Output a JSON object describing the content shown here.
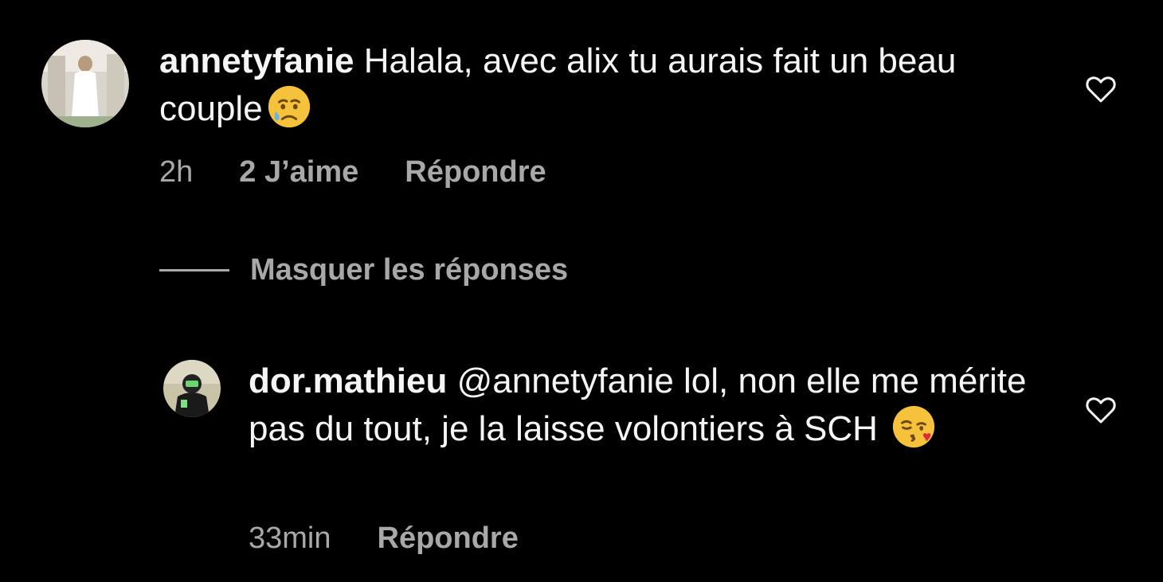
{
  "comments": [
    {
      "username": "annetyfanie",
      "text": "Halala, avec alix tu aurais fait un beau couple",
      "emoji": "crying-face-emoji",
      "time": "2h",
      "likes": "2 J’aime",
      "reply_label": "Répondre"
    }
  ],
  "replies_toggle": {
    "label": "Masquer les réponses"
  },
  "replies": [
    {
      "username": "dor.mathieu",
      "mention": "@annetyfanie",
      "text": "lol, non elle me mérite pas du tout, je la laisse volontiers à SCH",
      "emoji": "face-blowing-kiss-emoji",
      "time": "33min",
      "reply_label": "Répondre"
    }
  ],
  "colors": {
    "background": "#000000",
    "primary_text": "#f5f5f5",
    "secondary_text": "#a8a8a8"
  },
  "icons": {
    "like": "heart-outline-icon"
  }
}
